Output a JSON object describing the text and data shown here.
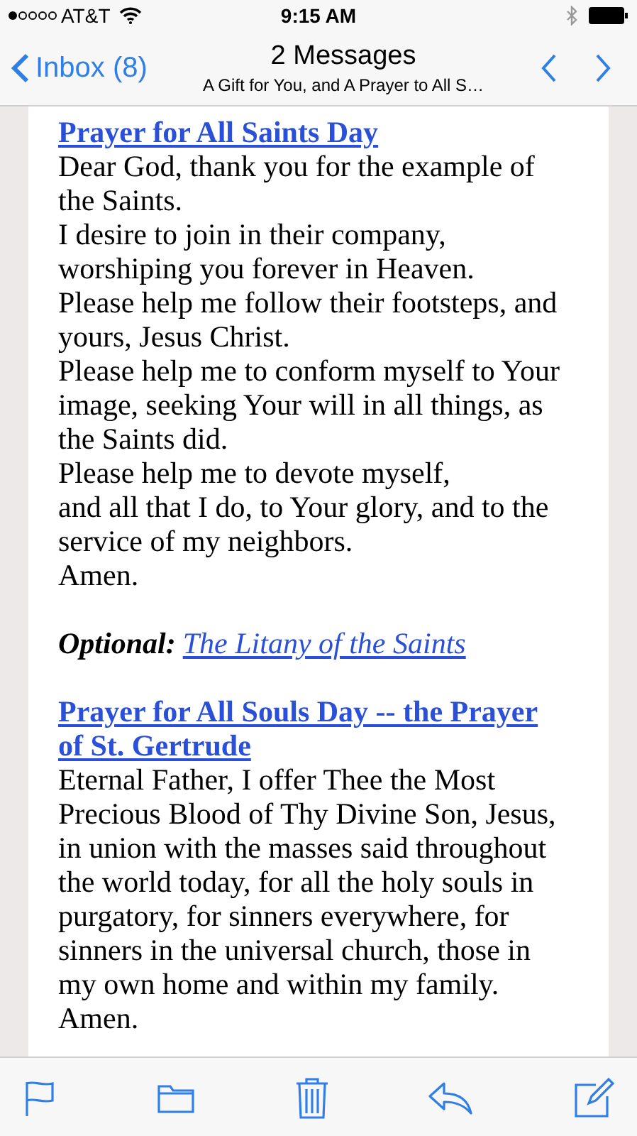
{
  "status_bar": {
    "carrier": "AT&T",
    "time": "9:15 AM"
  },
  "nav_bar": {
    "back": "Inbox (8)",
    "title": "2 Messages",
    "subtitle": "A Gift for You, and A Prayer to All S…"
  },
  "blocks": [
    {
      "kind": "prayer",
      "heading": "Prayer for All Saints Day",
      "lines": [
        "Dear God, thank you for the example of the Saints.",
        "I desire to join in their company, worshiping you forever in Heaven.",
        "Please help me follow their footsteps, and yours, Jesus Christ.",
        "Please help me to conform myself to Your image, seeking Your will in all things, as the Saints did.",
        "Please help me to devote myself,",
        "and all that I do, to Your glory, and to the service of my neighbors.",
        "Amen."
      ]
    },
    {
      "kind": "optional",
      "label": "Optional:",
      "link": "The Litany of the Saints"
    },
    {
      "kind": "prayer",
      "heading": "Prayer for All Souls Day -- the Prayer of St. Gertrude",
      "lines": [
        "Eternal Father, I offer Thee the Most Precious Blood of Thy Divine Son, Jesus, in union with the masses said throughout the world today, for all the holy souls in purgatory, for sinners everywhere, for sinners in the universal church, those in my own home and within my family.",
        "Amen."
      ]
    }
  ]
}
